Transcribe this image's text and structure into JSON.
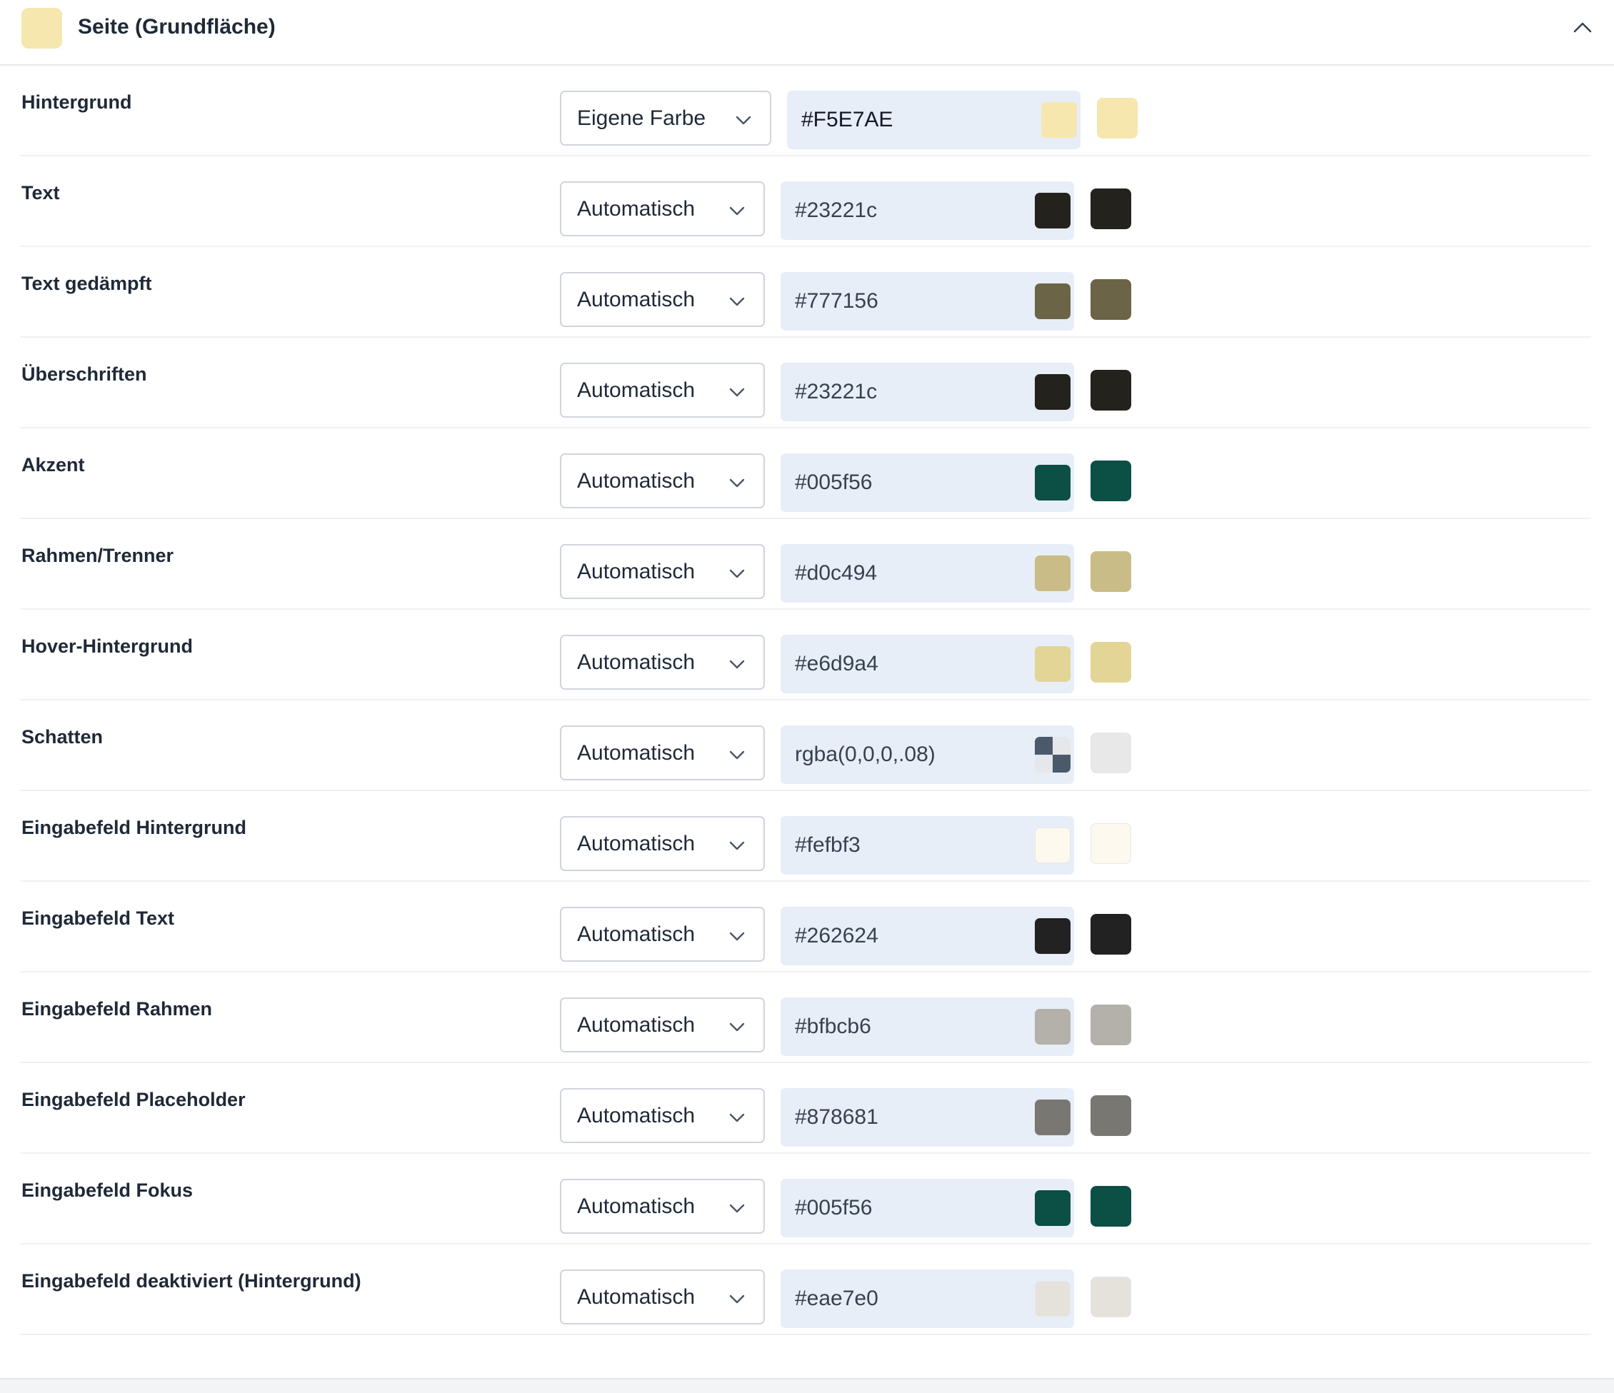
{
  "header": {
    "title": "Seite (Grundfläche)",
    "swatch_color": "#F5E7AE",
    "collapse_icon": "chevron-up-icon"
  },
  "rows": [
    {
      "label": "Hintergrund",
      "mode": "Eigene Farbe",
      "value": "#F5E7AE",
      "color": "#F5E7AE"
    },
    {
      "label": "Text",
      "mode": "Automatisch",
      "value": "#23221c",
      "color": "#23221c"
    },
    {
      "label": "Text gedämpft",
      "mode": "Automatisch",
      "value": "#777156",
      "color": "#6b6447"
    },
    {
      "label": "Überschriften",
      "mode": "Automatisch",
      "value": "#23221c",
      "color": "#23221c"
    },
    {
      "label": "Akzent",
      "mode": "Automatisch",
      "value": "#005f56",
      "color": "#0b4f45"
    },
    {
      "label": "Rahmen/Trenner",
      "mode": "Automatisch",
      "value": "#d0c494",
      "color": "#c9bc86"
    },
    {
      "label": "Hover-Hintergrund",
      "mode": "Automatisch",
      "value": "#e6d9a4",
      "color": "#e3d596"
    },
    {
      "label": "Schatten",
      "mode": "Automatisch",
      "value": "rgba(0,0,0,.08)",
      "color": "#e8e8e8"
    },
    {
      "label": "Eingabefeld Hintergrund",
      "mode": "Automatisch",
      "value": "#fefbf3",
      "color": "#fdf9ee"
    },
    {
      "label": "Eingabefeld Text",
      "mode": "Automatisch",
      "value": "#262624",
      "color": "#222222"
    },
    {
      "label": "Eingabefeld Rahmen",
      "mode": "Automatisch",
      "value": "#bfbcb6",
      "color": "#b4b1ab"
    },
    {
      "label": "Eingabefeld Placeholder",
      "mode": "Automatisch",
      "value": "#878681",
      "color": "#787771"
    },
    {
      "label": "Eingabefeld Fokus",
      "mode": "Automatisch",
      "value": "#005f56",
      "color": "#0b4f45"
    },
    {
      "label": "Eingabefeld deaktiviert (Hintergrund)",
      "mode": "Automatisch",
      "value": "#eae7e0",
      "color": "#e5e2dc"
    }
  ]
}
